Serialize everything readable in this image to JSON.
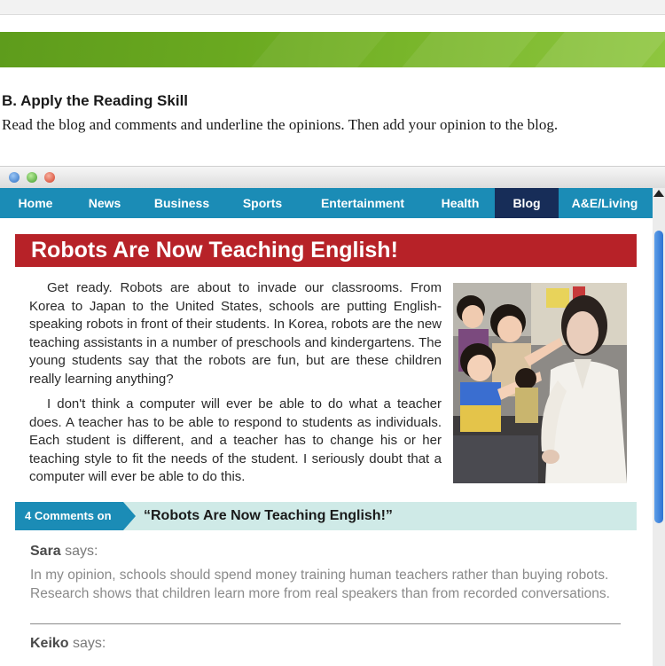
{
  "section": {
    "title": "B.  Apply the Reading Skill",
    "instructions": "Read the blog and comments and underline the opinions. Then add your opinion to the blog."
  },
  "browser": {
    "nav": [
      {
        "label": "Home",
        "active": false
      },
      {
        "label": "News",
        "active": false
      },
      {
        "label": "Business",
        "active": false
      },
      {
        "label": "Sports",
        "active": false
      },
      {
        "label": "Entertainment",
        "active": false
      },
      {
        "label": "Health",
        "active": false
      },
      {
        "label": "Blog",
        "active": true
      },
      {
        "label": "A&E/Living",
        "active": false
      }
    ]
  },
  "article": {
    "title": "Robots Are Now Teaching English!",
    "paragraphs": [
      "Get ready. Robots are about to invade our classrooms. From Korea to Japan to the United States, schools are putting English-speaking robots in front of their students. In Korea, robots are the new teaching assistants in a number of preschools and kindergartens. The young students say that the robots are fun, but are these children really learning anything?",
      "I don't think a computer will ever be able to do what a teacher does. A teacher has to be able to respond to students as individuals. Each student is different, and a teacher has to change his or her teaching style to fit the needs of the student. I seriously doubt that a computer will ever be able to do this."
    ]
  },
  "comments": {
    "count_label": "4 Comments on",
    "title": "“Robots Are Now Teaching English!”",
    "items": [
      {
        "name": "Sara",
        "says": "says:",
        "text": "In my opinion, schools should spend money training human teachers rather than buying robots. Research shows that children learn more from real speakers than from recorded conversations."
      },
      {
        "name": "Keiko",
        "says": "says:",
        "text": ""
      }
    ]
  },
  "colors": {
    "nav_bg": "#1b8cb6",
    "nav_active": "#172d58",
    "title_red": "#b72228",
    "comments_bg": "#cfeae7",
    "banner_green": "#6aa920"
  }
}
